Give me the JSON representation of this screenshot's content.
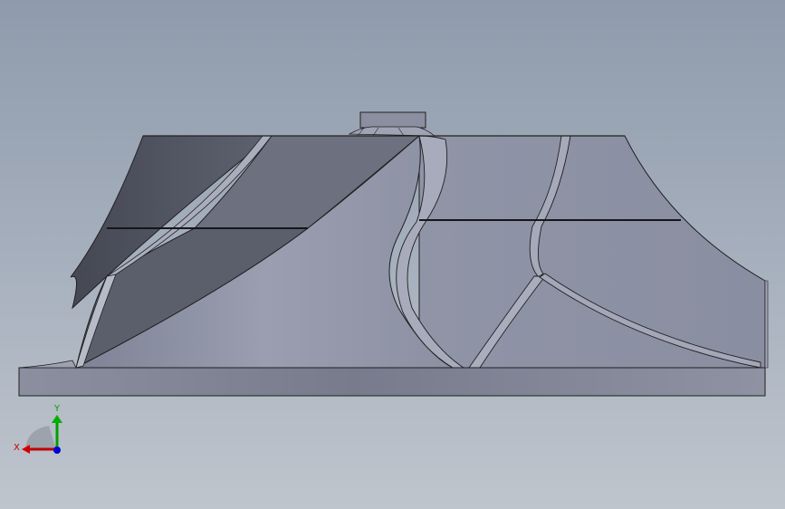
{
  "viewport": {
    "background_top": "#8f9bac",
    "background_bottom": "#bfc5cd"
  },
  "model": {
    "subject": "compressor-impeller",
    "face_color": "#8e93a6",
    "dark_face_color": "#4e525e",
    "edge_color": "#000000"
  },
  "triad": {
    "x_label": "X",
    "y_label": "Y",
    "x_color": "#c00000",
    "y_color": "#00a000",
    "z_color": "#0000d0"
  }
}
